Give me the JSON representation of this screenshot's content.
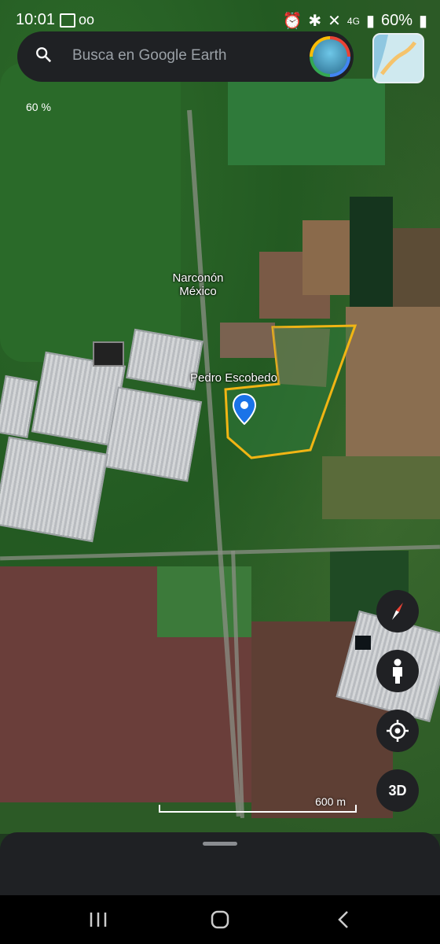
{
  "status_bar": {
    "time": "10:01",
    "battery": "60%",
    "network": "4G"
  },
  "search": {
    "placeholder": "Busca en Google Earth"
  },
  "map": {
    "tilt_label": "60 %",
    "place_labels": [
      "Narconón\nMéxico",
      "Pedro Escobedo"
    ],
    "scale_label": "600 m"
  },
  "controls": {
    "compass_icon": "compass-icon",
    "pegman_icon": "pegman-icon",
    "location_icon": "my-location-icon",
    "three_d_label": "3D"
  },
  "colors": {
    "accent": "#f1b514",
    "pin": "#1a73e8",
    "ui_dark": "#1f2124"
  }
}
